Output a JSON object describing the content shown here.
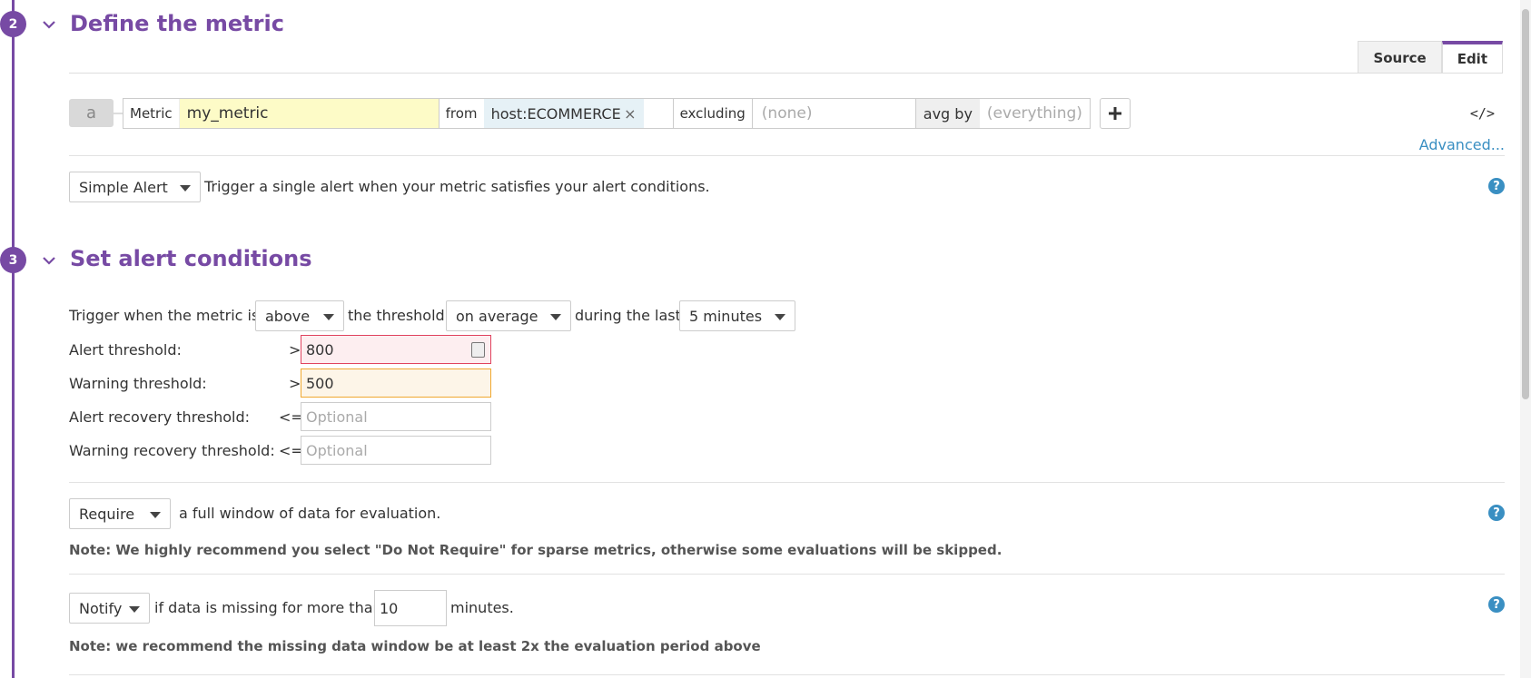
{
  "step2": {
    "number": "2",
    "title": "Define the metric"
  },
  "tabs": {
    "source": "Source",
    "edit": "Edit"
  },
  "query": {
    "letter": "a",
    "metric_label": "Metric",
    "metric_value": "my_metric",
    "from_label": "from",
    "from_tag": "host:ECOMMERCE",
    "tag_remove": "×",
    "excluding_label": "excluding",
    "excluding_placeholder": "(none)",
    "avgby_label": "avg by",
    "avgby_placeholder": "(everything)",
    "code_toggle": "</>",
    "advanced": "Advanced..."
  },
  "alert_type": {
    "selected": "Simple Alert",
    "description": "Trigger a single alert when your metric satisfies your alert conditions."
  },
  "step3": {
    "number": "3",
    "title": "Set alert conditions"
  },
  "trigger": {
    "prefix": "Trigger when the metric is",
    "comparison": "above",
    "middle": "the threshold",
    "aggregation": "on average",
    "during": "during the last",
    "window": "5 minutes"
  },
  "thresholds": [
    {
      "label": "Alert threshold:",
      "op": ">",
      "value": "800",
      "placeholder": ""
    },
    {
      "label": "Warning threshold:",
      "op": ">",
      "value": "500",
      "placeholder": ""
    },
    {
      "label": "Alert recovery threshold:",
      "op": "<=",
      "value": "",
      "placeholder": "Optional"
    },
    {
      "label": "Warning recovery threshold:",
      "op": "<=",
      "value": "",
      "placeholder": "Optional"
    }
  ],
  "require": {
    "selected": "Require",
    "text": "a full window of data for evaluation.",
    "note": "Note: We highly recommend you select \"Do Not Require\" for sparse metrics, otherwise some evaluations will be skipped."
  },
  "notify": {
    "selected": "Notify",
    "text_before": "if data is missing for more than",
    "minutes_value": "10",
    "text_after": "minutes.",
    "note": "Note: we recommend the missing data window be at least 2x the evaluation period above"
  },
  "help": "?",
  "colors": {
    "accent": "#774aa4",
    "link": "#3a8fc2",
    "alert": "#e0435f",
    "warning": "#f0a830"
  }
}
